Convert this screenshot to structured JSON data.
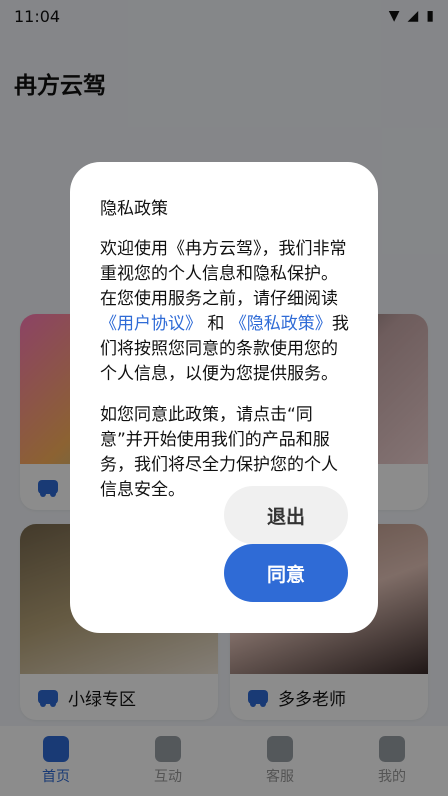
{
  "status_bar": {
    "time": "11:04"
  },
  "app": {
    "title": "冉方云驾"
  },
  "cards": [
    {
      "label": ""
    },
    {
      "label": ""
    },
    {
      "label": "小绿专区"
    },
    {
      "label": "多多老师"
    }
  ],
  "tabs": [
    {
      "label": "首页",
      "icon": "home-icon",
      "active": true
    },
    {
      "label": "互动",
      "icon": "car-icon",
      "active": false
    },
    {
      "label": "客服",
      "icon": "chat-icon",
      "active": false
    },
    {
      "label": "我的",
      "icon": "user-icon",
      "active": false
    }
  ],
  "modal": {
    "title": "隐私政策",
    "p1_before": "欢迎使用《冉方云驾》，我们非常重视您的个人信息和隐私保护。在您使用服务之前，请仔细阅读",
    "link_user_agreement": "《用户协议》",
    "and": " 和 ",
    "link_privacy_policy": "《隐私政策》",
    "p1_after": "我们将按照您同意的条款使用您的个人信息，以便为您提供服务。",
    "p2": "如您同意此政策，请点击“同意”并开始使用我们的产品和服务，我们将尽全力保护您的个人信息安全。",
    "exit_label": "退出",
    "agree_label": "同意"
  },
  "colors": {
    "accent": "#2f6bd6"
  }
}
